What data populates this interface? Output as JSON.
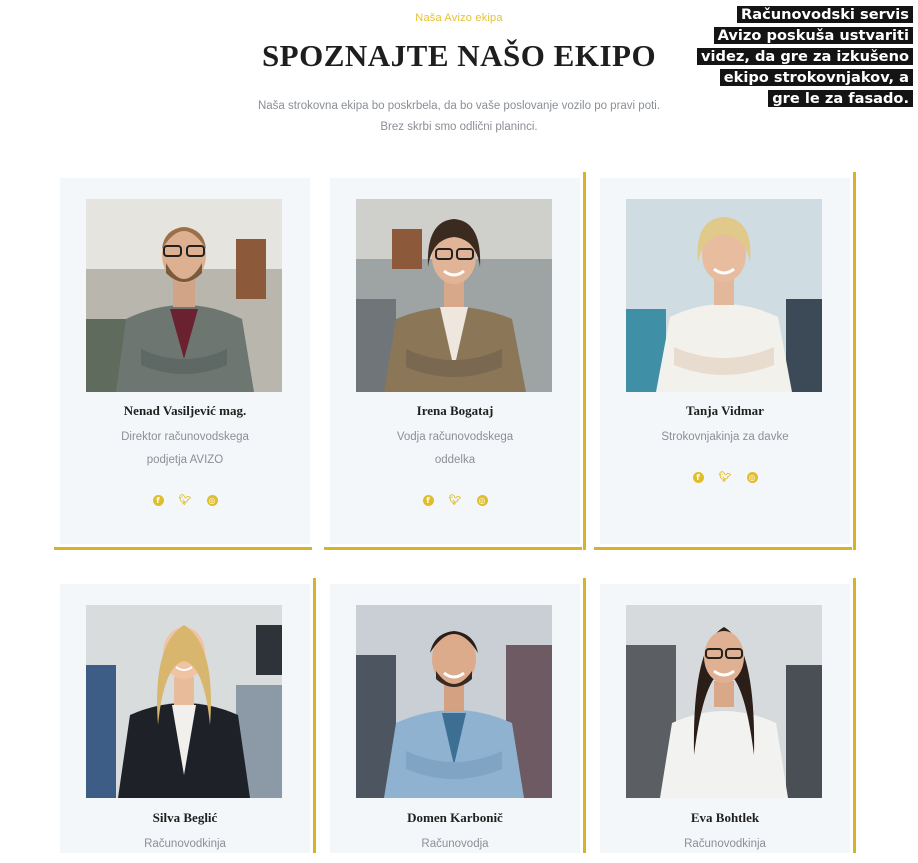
{
  "header": {
    "eyebrow": "Naša Avizo ekipa",
    "title": "SPOZNAJTE NAŠO EKIPO",
    "intro": "Naša strokovna ekipa bo poskrbela, da bo vaše poslovanje vozilo po pravi poti. Brez skrbi smo odlični planinci."
  },
  "caption": {
    "lines": [
      "Računovodski servis",
      "Avizo poskuša ustvariti",
      "videz, da gre za izkušeno",
      "ekipo strokovnjakov, a",
      "gre le za fasado."
    ]
  },
  "team": [
    {
      "name": "Nenad Vasiljević mag.",
      "role_lines": [
        "Direktor računovodskega",
        "podjetja AVIZO"
      ]
    },
    {
      "name": "Irena Bogataj",
      "role_lines": [
        "Vodja računovodskega",
        "oddelka"
      ]
    },
    {
      "name": "Tanja Vidmar",
      "role_lines": [
        "Strokovnjakinja za davke"
      ]
    },
    {
      "name": "Silva Beglić",
      "role_lines": [
        "Računovodkinja"
      ]
    },
    {
      "name": "Domen Karbonič",
      "role_lines": [
        "Računovodja"
      ]
    },
    {
      "name": "Eva Bohtlek",
      "role_lines": [
        "Računovodkinja"
      ]
    }
  ],
  "social_icons": [
    "facebook-icon",
    "twitter-icon",
    "instagram-icon"
  ],
  "colors": {
    "accent": "#d6b42a",
    "card_background": "#f4f7f9",
    "title": "#1e1e1e",
    "muted_text": "#8b9097"
  }
}
